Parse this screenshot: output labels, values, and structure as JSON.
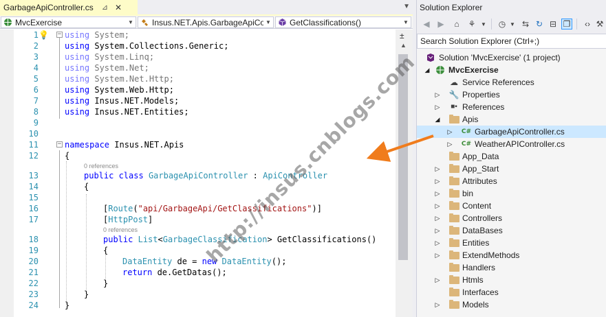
{
  "editor": {
    "tab": {
      "title": "GarbageApiController.cs",
      "pin_glyph": "⊿",
      "close_glyph": "✕"
    },
    "nav": {
      "project": "MvcExercise",
      "type": "Insus.NET.Apis.GarbageApiCo",
      "member": "GetClassifications()"
    },
    "lines": [
      {
        "n": "",
        "refs": ""
      },
      {
        "n": "1"
      },
      {
        "n": "2"
      },
      {
        "n": "3"
      },
      {
        "n": "4"
      },
      {
        "n": "5"
      },
      {
        "n": "6"
      },
      {
        "n": "7"
      },
      {
        "n": "8"
      },
      {
        "n": "9"
      },
      {
        "n": "10"
      },
      {
        "n": "11"
      },
      {
        "n": "12"
      },
      {
        "n": "13"
      },
      {
        "n": "14"
      },
      {
        "n": "15"
      },
      {
        "n": "16"
      },
      {
        "n": "17"
      },
      {
        "n": "18"
      },
      {
        "n": "19"
      },
      {
        "n": "20"
      },
      {
        "n": "21"
      },
      {
        "n": "22"
      },
      {
        "n": "23"
      },
      {
        "n": "24"
      }
    ],
    "code": {
      "u1": "System;",
      "u2": "System.Collections.Generic;",
      "u3": "System.Linq;",
      "u4": "System.Net;",
      "u5": "System.Net.Http;",
      "u6": "System.Web.Http;",
      "u7": "Insus.NET.Models;",
      "u8": "Insus.NET.Entities;",
      "kw_using": "using",
      "kw_namespace": "namespace",
      "ns_name": " Insus.NET.Apis",
      "brace_open": "{",
      "brace_close": "}",
      "refs0": "0 references",
      "class_decl_kw": "public class",
      "class_name": "GarbageApiController",
      "class_sep": " : ",
      "base_class": "ApiController",
      "attr_route_open": "[",
      "attr_route": "Route",
      "attr_route_str": "\"api/GarbageApi/GetClassifications\"",
      "attr_route_close": ")]",
      "attr_post": "HttpPost",
      "method_kw": "public",
      "list_type": "List",
      "gen_type": "GarbageClassification",
      "method_name": " GetClassifications()",
      "entity_type": "DataEntity",
      "var_decl": " de = ",
      "kw_new": "new",
      "ctor_call": "();",
      "kw_return": "return",
      "return_expr": " de.GetDatas();"
    }
  },
  "solution_explorer": {
    "title": "Solution Explorer",
    "search_placeholder": "Search Solution Explorer (Ctrl+;)",
    "tree": [
      {
        "label": "Solution 'MvcExercise' (1 project)",
        "level": 0,
        "icon": "solution-icon",
        "expander": ""
      },
      {
        "label": "MvcExercise",
        "level": 1,
        "icon": "web-project-icon",
        "expander": "◢",
        "bold": true
      },
      {
        "label": "Service References",
        "level": 2,
        "icon": "service-references-icon",
        "expander": ""
      },
      {
        "label": "Properties",
        "level": 2,
        "icon": "wrench-icon",
        "expander": "▷"
      },
      {
        "label": "References",
        "level": 2,
        "icon": "references-icon",
        "expander": "▷"
      },
      {
        "label": "Apis",
        "level": 2,
        "icon": "folder-open-icon",
        "expander": "◢"
      },
      {
        "label": "GarbageApiController.cs",
        "level": 3,
        "icon": "csharp-file-icon",
        "expander": "▷",
        "selected": true
      },
      {
        "label": "WeatherAPIController.cs",
        "level": 3,
        "icon": "csharp-file-icon",
        "expander": "▷"
      },
      {
        "label": "App_Data",
        "level": 2,
        "icon": "folder-icon",
        "expander": ""
      },
      {
        "label": "App_Start",
        "level": 2,
        "icon": "folder-icon",
        "expander": "▷"
      },
      {
        "label": "Attributes",
        "level": 2,
        "icon": "folder-icon",
        "expander": "▷"
      },
      {
        "label": "bin",
        "level": 2,
        "icon": "folder-icon",
        "expander": "▷"
      },
      {
        "label": "Content",
        "level": 2,
        "icon": "folder-icon",
        "expander": "▷"
      },
      {
        "label": "Controllers",
        "level": 2,
        "icon": "folder-icon",
        "expander": "▷"
      },
      {
        "label": "DataBases",
        "level": 2,
        "icon": "folder-icon",
        "expander": "▷"
      },
      {
        "label": "Entities",
        "level": 2,
        "icon": "folder-icon",
        "expander": "▷"
      },
      {
        "label": "ExtendMethods",
        "level": 2,
        "icon": "folder-icon",
        "expander": "▷"
      },
      {
        "label": "Handlers",
        "level": 2,
        "icon": "folder-icon",
        "expander": ""
      },
      {
        "label": "Htmls",
        "level": 2,
        "icon": "folder-icon",
        "expander": "▷"
      },
      {
        "label": "Interfaces",
        "level": 2,
        "icon": "folder-icon",
        "expander": ""
      },
      {
        "label": "Models",
        "level": 2,
        "icon": "folder-icon",
        "expander": "▷"
      }
    ]
  },
  "watermark": "http://insus.cnblogs.com",
  "colors": {
    "accent_orange": "#f07c1c",
    "keyword": "#0000ff",
    "type": "#2b91af",
    "string": "#a31515",
    "selection": "#cce8ff"
  }
}
